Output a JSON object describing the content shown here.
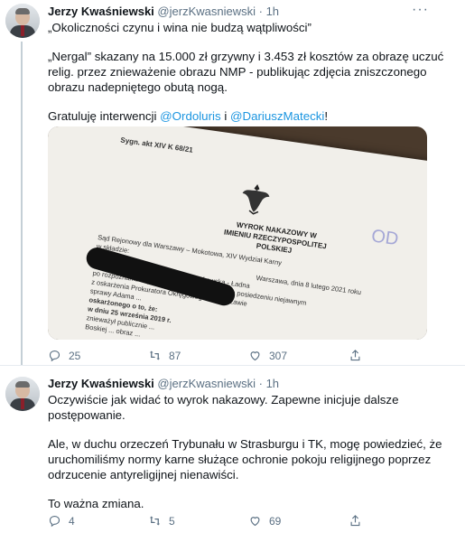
{
  "tweets": [
    {
      "author_name": "Jerzy Kwaśniewski",
      "handle": "@jerzKwasniewski",
      "separator": "·",
      "time": "1h",
      "more": "···",
      "line1": "„Okoliczności czynu i wina nie budzą wątpliwości”",
      "line2": "„Nergal” skazany na 15.000 zł grzywny i 3.453 zł kosztów za obrazę uczuć relig. przez znieważenie obrazu NMP - publikując zdjęcia zniszczonego obrazu nadepniętego obutą nogą.",
      "line3_prefix": "Gratuluję interwencji ",
      "mention1": "@Ordoluris",
      "line3_mid": " i ",
      "mention2": "@DariuszMatecki",
      "line3_suffix": "!",
      "media": {
        "sygn": "Sygn. akt XIV K 68/21",
        "title": "WYROK NAKAZOWY W IMIENIU RZECZYPOSPOLITEJ POLSKIEJ",
        "stamp": "OD",
        "body_lines": [
          "Sąd Rejonowy dla Warszawy – Mokotowa, XIV Wydział Karny",
          "w składzie:",
          "Przewodniczący: Sędzia Wioletta Bąkowska - Ładna",
          "po rozpoznaniu w postępowaniu nakazowym na posiedzeniu niejawnym",
          "z oskarżenia Prokuratora Okręgowego w Warszawie",
          "sprawy Adama ...",
          "oskarżonego o to, że:",
          "w dniu 25 września 2019 r.",
          "znieważył publicznie ...",
          "Boskiej ... obraz ..."
        ],
        "date_line": "Warszawa, dnia 8 lutego 2021 roku"
      },
      "replies": "25",
      "retweets": "87",
      "likes": "307"
    },
    {
      "author_name": "Jerzy Kwaśniewski",
      "handle": "@jerzKwasniewski",
      "separator": "·",
      "time": "1h",
      "para1": "Oczywiście jak widać to wyrok nakazowy. Zapewne inicjuje dalsze postępowanie.",
      "para2": "Ale, w duchu orzeczeń Trybunału w Strasburgu i TK, mogę powiedzieć, że uruchomiliśmy normy karne służące ochronie pokoju religijnego poprzez odrzucenie antyreligijnej nienawiści.",
      "para3": "To ważna zmiana.",
      "replies": "4",
      "retweets": "5",
      "likes": "69"
    }
  ],
  "icons": [
    "reply-icon",
    "retweet-icon",
    "like-icon",
    "share-icon",
    "more-icon"
  ],
  "colors": {
    "link": "#1b95e0",
    "muted": "#5b7083",
    "thread_line": "#c4cfd6"
  }
}
